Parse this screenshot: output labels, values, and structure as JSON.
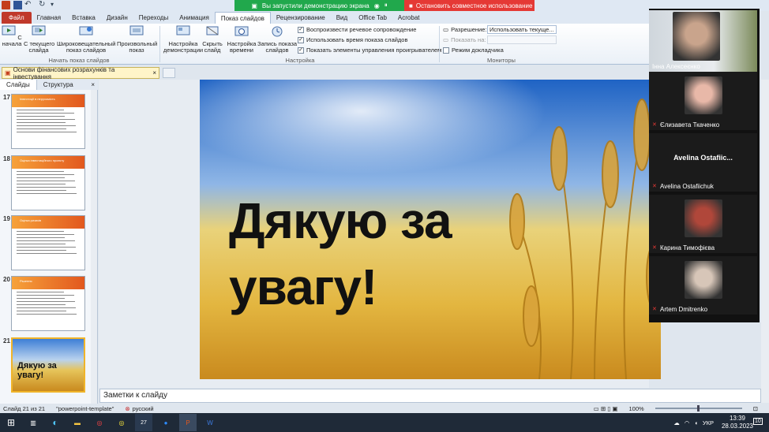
{
  "share_bar": {
    "status": "Вы запустили демонстрацию экрана",
    "stop": "Остановить совместное использование"
  },
  "tabs": [
    "Файл",
    "Главная",
    "Вставка",
    "Дизайн",
    "Переходы",
    "Анимация",
    "Показ слайдов",
    "Рецензирование",
    "Вид",
    "Office Tab",
    "Acrobat"
  ],
  "active_tab": "Показ слайдов",
  "ribbon": {
    "from_start": "С\nначала",
    "from_current": "С текущего\nслайда",
    "broadcast": "Широковещательный\nпоказ слайдов",
    "custom": "Произвольный\nпоказ",
    "group1": "Начать показ слайдов",
    "setup": "Настройка\nдемонстрации",
    "hide": "Скрыть\nслайд",
    "rehearse": "Настройка\nвремени",
    "record": "Запись показа\nслайдов",
    "chk_narration": "Воспроизвести речевое сопровождение",
    "chk_timings": "Использовать время показа слайдов",
    "chk_controls": "Показать элементы управления проигрывателем",
    "group2": "Настройка",
    "resolution_label": "Разрешение:",
    "resolution_value": "Использовать текуще...",
    "show_on_label": "Показать на:",
    "presenter_view": "Режим докладчика",
    "group3": "Мониторы"
  },
  "doc_tab": "Основи фінансових розрахунків та інвестування",
  "pane_tabs": {
    "slides": "Слайды",
    "outline": "Структура"
  },
  "slides": [
    {
      "num": "17",
      "title": "Інвестиції в нерухомість"
    },
    {
      "num": "18",
      "title": "Оцінка інвестиційного проекту"
    },
    {
      "num": "19",
      "title": "Оцінка ризиків"
    },
    {
      "num": "20",
      "title": "Рішення"
    },
    {
      "num": "21",
      "title": "Дякую за увагу!"
    }
  ],
  "slide_text": "Дякую за увагу!",
  "notes_placeholder": "Заметки к слайду",
  "status": {
    "slide": "Слайд 21 из 21",
    "theme": "\"powerpoint-template\"",
    "lang": "русский",
    "zoom": "100%"
  },
  "participants": [
    {
      "name": "Інна Алексеєнко",
      "muted": false
    },
    {
      "name": "Єлизавета Ткаченко",
      "muted": true
    },
    {
      "name": "Avelina Ostafiichuk",
      "label": "Avelina Ostafiic...",
      "muted": true
    },
    {
      "name": "Карина Тимофієва",
      "muted": true
    },
    {
      "name": "Artem Dmitrenko",
      "muted": true
    }
  ],
  "taskbar": {
    "time": "13:39",
    "date": "28.03.2023",
    "lang": "УКР",
    "badge": "27",
    "notif": "10"
  }
}
